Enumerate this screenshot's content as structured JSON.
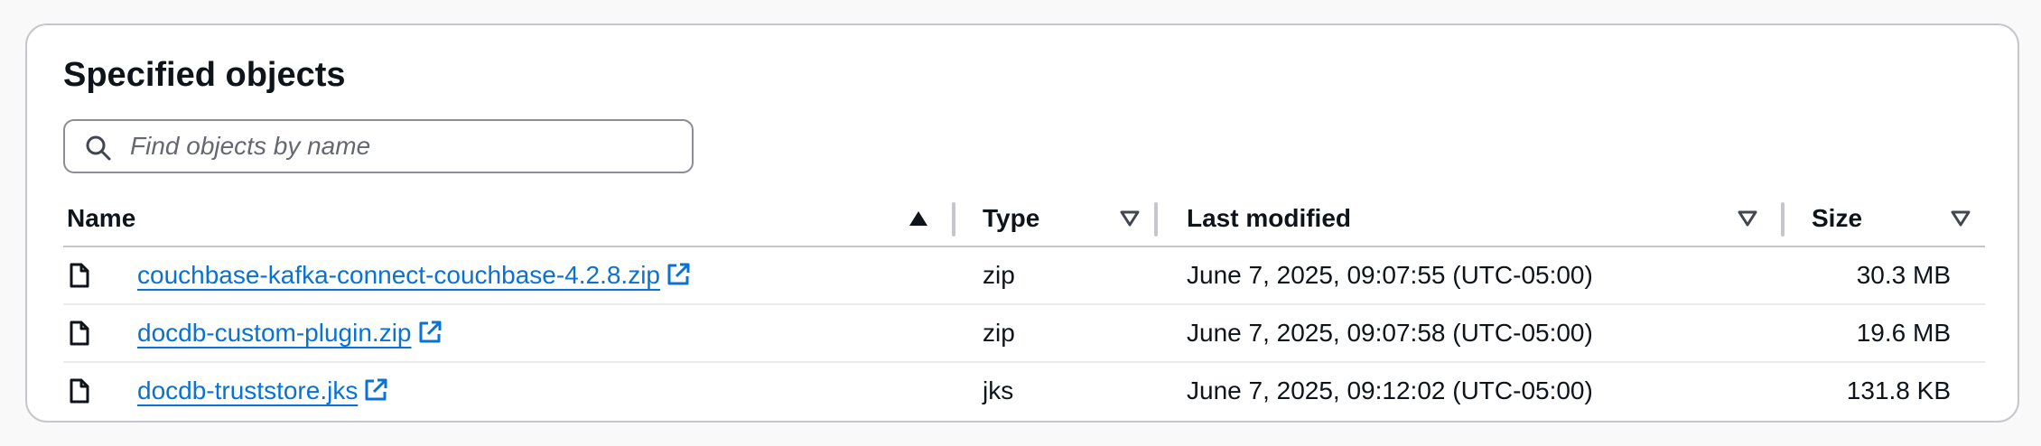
{
  "title": "Specified objects",
  "search": {
    "placeholder": "Find objects by name",
    "value": ""
  },
  "table": {
    "columns": [
      {
        "label": "Name",
        "sort": "ascending"
      },
      {
        "label": "Type",
        "sort": "none"
      },
      {
        "label": "Last modified",
        "sort": "none"
      },
      {
        "label": "Size",
        "sort": "none"
      }
    ],
    "rows": [
      {
        "name": "couchbase-kafka-connect-couchbase-4.2.8.zip",
        "type": "zip",
        "modified": "June 7, 2025, 09:07:55 (UTC-05:00)",
        "size": "30.3 MB"
      },
      {
        "name": "docdb-custom-plugin.zip",
        "type": "zip",
        "modified": "June 7, 2025, 09:07:58 (UTC-05:00)",
        "size": "19.6 MB"
      },
      {
        "name": "docdb-truststore.jks",
        "type": "jks",
        "modified": "June 7, 2025, 09:12:02 (UTC-05:00)",
        "size": "131.8 KB"
      }
    ]
  },
  "icons": {
    "search": "search-icon",
    "file": "file-icon",
    "external": "external-link-icon",
    "sort_asc": "sort-ascending-icon",
    "sort_none": "sort-descending-outline-icon"
  },
  "colors": {
    "link": "#0972d3",
    "text": "#0f141a",
    "border": "#c6c6cd"
  }
}
